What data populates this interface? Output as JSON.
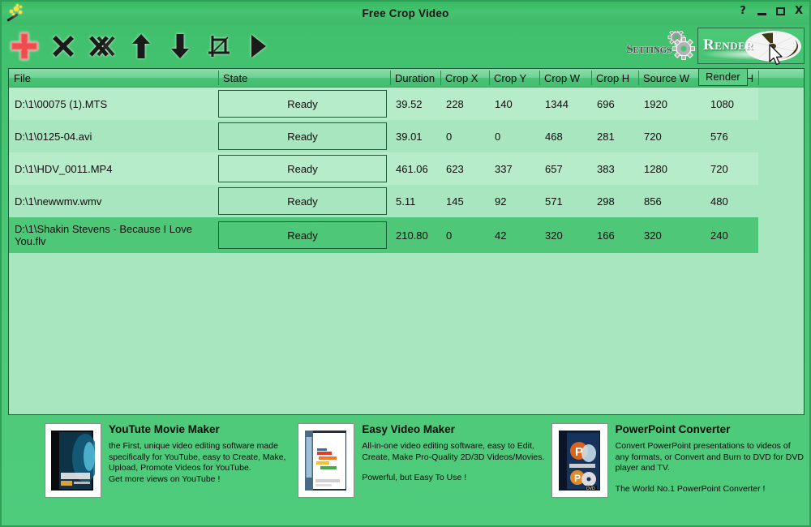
{
  "window": {
    "title": "Free Crop Video",
    "app_icon": "magic-wand-icon",
    "controls": {
      "help": "?",
      "minimize": "_",
      "maximize": "□",
      "close": "X"
    }
  },
  "toolbar": {
    "buttons": [
      {
        "name": "add-file",
        "icon": "plus-icon",
        "label": "Add"
      },
      {
        "name": "remove-file",
        "icon": "x-icon",
        "label": "Remove"
      },
      {
        "name": "remove-all-files",
        "icon": "double-x-icon",
        "label": "Remove All"
      },
      {
        "name": "move-up",
        "icon": "arrow-up-icon",
        "label": "Move Up"
      },
      {
        "name": "move-down",
        "icon": "arrow-down-icon",
        "label": "Move Down"
      },
      {
        "name": "crop",
        "icon": "crop-icon",
        "label": "Crop"
      },
      {
        "name": "play",
        "icon": "play-icon",
        "label": "Play"
      }
    ],
    "settings_label": "Settings",
    "render_label": "Render",
    "render_tooltip": "Render"
  },
  "table": {
    "columns": [
      {
        "key": "file",
        "label": "File"
      },
      {
        "key": "state",
        "label": "State"
      },
      {
        "key": "duration",
        "label": "Duration"
      },
      {
        "key": "crop_x",
        "label": "Crop X"
      },
      {
        "key": "crop_y",
        "label": "Crop Y"
      },
      {
        "key": "crop_w",
        "label": "Crop W"
      },
      {
        "key": "crop_h",
        "label": "Crop H"
      },
      {
        "key": "source_w",
        "label": "Source W"
      },
      {
        "key": "source_h",
        "label": "Source H"
      },
      {
        "key": "extra",
        "label": ""
      }
    ],
    "rows": [
      {
        "file": "D:\\1\\00075 (1).MTS",
        "state": "Ready",
        "duration": "39.52",
        "crop_x": "228",
        "crop_y": "140",
        "crop_w": "1344",
        "crop_h": "696",
        "source_w": "1920",
        "source_h": "1080",
        "selected": false
      },
      {
        "file": "D:\\1\\0125-04.avi",
        "state": "Ready",
        "duration": "39.01",
        "crop_x": "0",
        "crop_y": "0",
        "crop_w": "468",
        "crop_h": "281",
        "source_w": "720",
        "source_h": "576",
        "selected": false
      },
      {
        "file": "D:\\1\\HDV_0011.MP4",
        "state": "Ready",
        "duration": "461.06",
        "crop_x": "623",
        "crop_y": "337",
        "crop_w": "657",
        "crop_h": "383",
        "source_w": "1280",
        "source_h": "720",
        "selected": false
      },
      {
        "file": "D:\\1\\newwmv.wmv",
        "state": "Ready",
        "duration": "5.11",
        "crop_x": "145",
        "crop_y": "92",
        "crop_w": "571",
        "crop_h": "298",
        "source_w": "856",
        "source_h": "480",
        "selected": false
      },
      {
        "file": "D:\\1\\Shakin Stevens - Because I Love You.flv",
        "state": "Ready",
        "duration": "210.80",
        "crop_x": "0",
        "crop_y": "42",
        "crop_w": "320",
        "crop_h": "166",
        "source_w": "320",
        "source_h": "240",
        "selected": true
      }
    ]
  },
  "ads": [
    {
      "title": "YouTute Movie Maker",
      "thumb": "movie-maker-box-art",
      "desc": "the First, unique video editing software made specifically for YouTube, easy to Create, Make, Upload, Promote Videos for YouTube.",
      "tagline": "Get more views on YouTube !"
    },
    {
      "title": "Easy Video Maker",
      "thumb": "easy-video-maker-box-art",
      "desc": "All-in-one video editing software, easy to Edit, Create, Make Pro-Quality 2D/3D Videos/Movies.",
      "tagline": "Powerful, but Easy To Use !"
    },
    {
      "title": "PowerPoint Converter",
      "thumb": "powerpoint-converter-box-art",
      "desc": "Convert PowerPoint presentations to videos of any formats, or Convert and Burn to DVD for DVD player and TV.",
      "tagline": "The World No.1 PowerPoint Converter !"
    }
  ],
  "colors": {
    "window_green": "#4ec878",
    "title_green": "#41c06c",
    "row_light": "#b6ecca",
    "row_dark": "#a7e6bf",
    "row_selected": "#4ec878",
    "border_dark": "#1c5c36",
    "plus_red": "#ef4d4d"
  }
}
